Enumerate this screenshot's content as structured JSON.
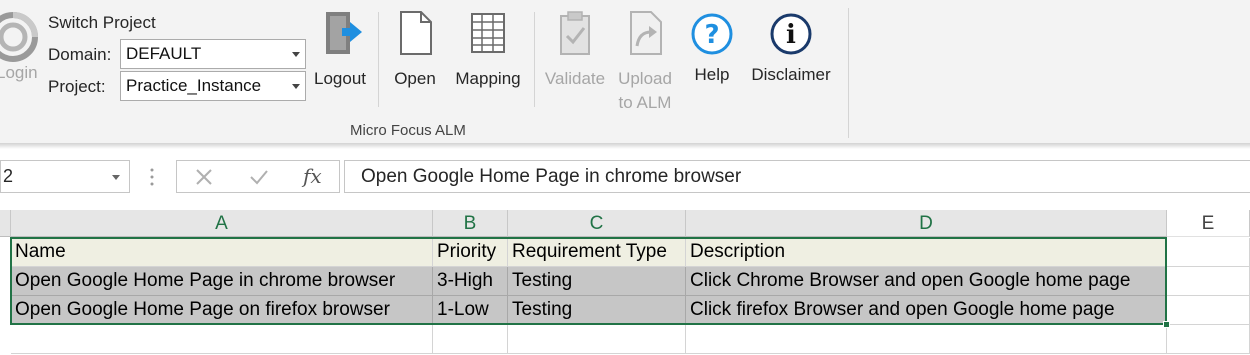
{
  "ribbon": {
    "login_label": "Login",
    "switch_project_label": "Switch Project",
    "domain_label": "Domain:",
    "domain_value": "DEFAULT",
    "project_label": "Project:",
    "project_value": "Practice_Instance",
    "group_label": "Micro Focus ALM",
    "buttons": {
      "logout": "Logout",
      "open": "Open",
      "mapping": "Mapping",
      "validate": "Validate",
      "upload_line1": "Upload",
      "upload_line2": "to ALM",
      "help": "Help",
      "disclaimer": "Disclaimer"
    },
    "colors": {
      "accent": "#1f6fb5",
      "disabled": "#a6a6a6"
    },
    "icons": [
      "alm-logo-icon",
      "logout-icon",
      "open-document-icon",
      "mapping-grid-icon",
      "validate-clipboard-icon",
      "upload-icon",
      "help-icon",
      "info-icon"
    ]
  },
  "formula_bar": {
    "name_box": "2",
    "fx_symbol": "fx",
    "formula": "Open Google Home Page in chrome browser"
  },
  "grid": {
    "columns": [
      "A",
      "B",
      "C",
      "D",
      "E"
    ],
    "header_row": [
      "Name",
      "Priority",
      "Requirement Type",
      "Description"
    ],
    "rows": [
      [
        "Open Google Home Page in chrome browser",
        "3-High",
        "Testing",
        "Click Chrome Browser and open Google home page"
      ],
      [
        "Open Google Home Page on firefox browser",
        "1-Low",
        "Testing",
        "Click firefox Browser and open Google home page"
      ]
    ],
    "selection_color": "#217346"
  }
}
